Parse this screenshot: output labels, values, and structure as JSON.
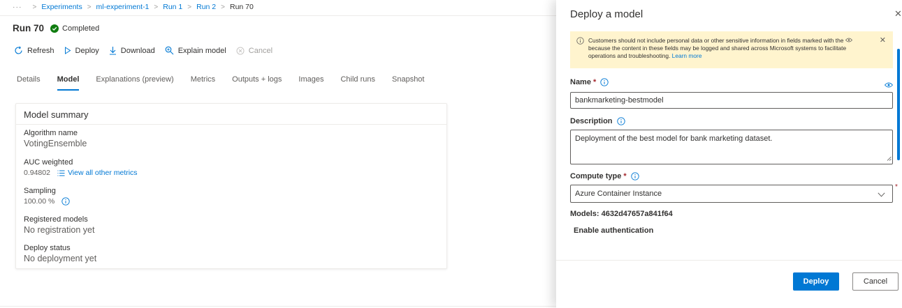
{
  "breadcrumb": {
    "overflow": "···",
    "items": [
      "Experiments",
      "ml-experiment-1",
      "Run 1",
      "Run 2"
    ],
    "current": "Run 70",
    "separator": ">"
  },
  "run": {
    "title": "Run 70",
    "status": "Completed",
    "status_color": "#107c10"
  },
  "toolbar": {
    "refresh": "Refresh",
    "deploy": "Deploy",
    "download": "Download",
    "explain": "Explain model",
    "cancel": "Cancel"
  },
  "tabs": [
    "Details",
    "Model",
    "Explanations (preview)",
    "Metrics",
    "Outputs + logs",
    "Images",
    "Child runs",
    "Snapshot"
  ],
  "active_tab": "Model",
  "model_summary": {
    "title": "Model summary",
    "algorithm_label": "Algorithm name",
    "algorithm_value": "VotingEnsemble",
    "auc_label": "AUC weighted",
    "auc_value": "0.94802",
    "metrics_link": "View all other metrics",
    "sampling_label": "Sampling",
    "sampling_value": "100.00 %",
    "registered_label": "Registered models",
    "registered_value": "No registration yet",
    "deploy_status_label": "Deploy status",
    "deploy_status_value": "No deployment yet"
  },
  "panel": {
    "title": "Deploy a model",
    "close": "✕",
    "notice_text": "Customers should not include personal data or other sensitive information in fields marked with the",
    "notice_text2": "because the content in these fields may be logged and shared across Microsoft systems to facilitate operations and troubleshooting.",
    "notice_link": "Learn more",
    "name_label": "Name",
    "name_value": "bankmarketing-bestmodel",
    "description_label": "Description",
    "description_value": "Deployment of the best model for bank marketing dataset.",
    "compute_label": "Compute type",
    "compute_value": "Azure Container Instance",
    "models_line": "Models: 4632d47657a841f64",
    "enable_auth": "Enable authentication",
    "required_mark": "*",
    "deploy_button": "Deploy",
    "cancel_button": "Cancel"
  },
  "colors": {
    "accent": "#0078d4",
    "warning_bg": "#fff4ce",
    "required": "#a4262c"
  }
}
